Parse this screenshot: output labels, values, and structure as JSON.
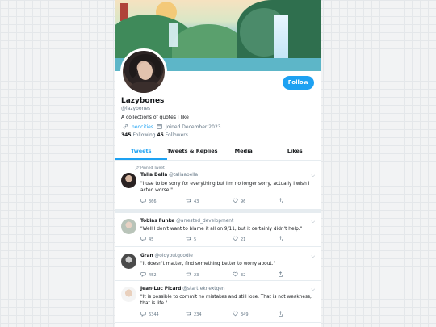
{
  "profile": {
    "display_name": "Lazybones",
    "handle": "@lazybones",
    "bio": "A collections of quotes I like",
    "link": "neocities",
    "joined": "Joined December 2023",
    "following_count": "345",
    "following_label": "Following",
    "followers_count": "45",
    "followers_label": "Followers",
    "follow_label": "Follow"
  },
  "tabs": [
    {
      "label": "Tweets",
      "active": true
    },
    {
      "label": "Tweets & Replies",
      "active": false
    },
    {
      "label": "Media",
      "active": false
    },
    {
      "label": "Likes",
      "active": false
    }
  ],
  "tweets": [
    {
      "pinned_label": "Pinned Tweet",
      "name": "Talia Bella",
      "handle": "@taliaabella",
      "text": "\"I use to be sorry for everything but I'm no longer sorry, actually I wish I acted worse.\"",
      "replies": "366",
      "retweets": "43",
      "likes": "96"
    },
    {
      "name": "Tobias Funke",
      "handle": "@arrested_development",
      "text": "\"Well I don't want to blame it all on 9/11, but it certainly didn't help.\"",
      "replies": "45",
      "retweets": "5",
      "likes": "21"
    },
    {
      "name": "Gran",
      "handle": "@oldybutgoodie",
      "text": "\"It doesn't matter, find something better to worry about.\"",
      "replies": "452",
      "retweets": "23",
      "likes": "32"
    },
    {
      "name": "Jean-Luc Picard",
      "handle": "@startreknextgen",
      "text": "\"It is possible to commit no mistakes and still lose. That is not weakness, that is life.\"",
      "replies": "6344",
      "retweets": "234",
      "likes": "349"
    }
  ],
  "colors": {
    "accent": "#1da1f2",
    "text": "#14171a",
    "muted": "#657786"
  }
}
